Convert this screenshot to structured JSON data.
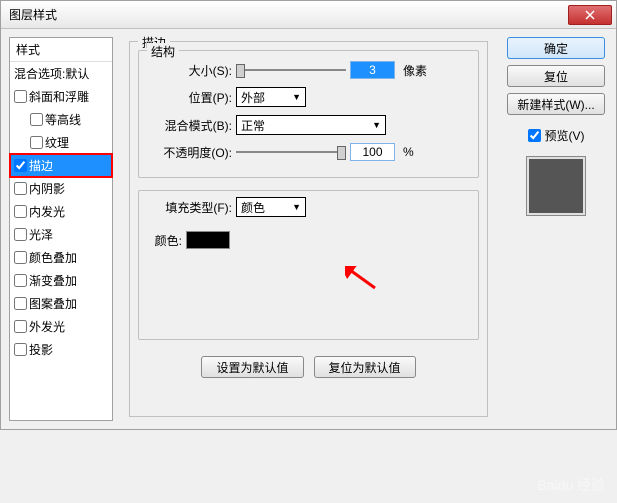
{
  "titlebar": {
    "title": "图层样式"
  },
  "sidebar": {
    "header": "样式",
    "blendopts": "混合选项:默认",
    "items": [
      {
        "label": "斜面和浮雕",
        "checked": false,
        "indent": false
      },
      {
        "label": "等高线",
        "checked": false,
        "indent": true
      },
      {
        "label": "纹理",
        "checked": false,
        "indent": true
      },
      {
        "label": "描边",
        "checked": true,
        "indent": false,
        "selected": true
      },
      {
        "label": "内阴影",
        "checked": false,
        "indent": false
      },
      {
        "label": "内发光",
        "checked": false,
        "indent": false
      },
      {
        "label": "光泽",
        "checked": false,
        "indent": false
      },
      {
        "label": "颜色叠加",
        "checked": false,
        "indent": false
      },
      {
        "label": "渐变叠加",
        "checked": false,
        "indent": false
      },
      {
        "label": "图案叠加",
        "checked": false,
        "indent": false
      },
      {
        "label": "外发光",
        "checked": false,
        "indent": false
      },
      {
        "label": "投影",
        "checked": false,
        "indent": false
      }
    ]
  },
  "main": {
    "group_title": "描边",
    "structure_title": "结构",
    "size": {
      "label": "大小(S):",
      "value": "3",
      "unit": "像素"
    },
    "position": {
      "label": "位置(P):",
      "value": "外部"
    },
    "blend": {
      "label": "混合模式(B):",
      "value": "正常"
    },
    "opacity": {
      "label": "不透明度(O):",
      "value": "100",
      "unit": "%"
    },
    "filltype": {
      "label": "填充类型(F):",
      "value": "颜色"
    },
    "color_label": "颜色:",
    "defaults_btn": "设置为默认值",
    "reset_btn": "复位为默认值"
  },
  "right": {
    "ok": "确定",
    "reset": "复位",
    "newstyle": "新建样式(W)...",
    "preview_label": "预览(V)",
    "preview_checked": true
  },
  "watermark": "Baidu 经验"
}
